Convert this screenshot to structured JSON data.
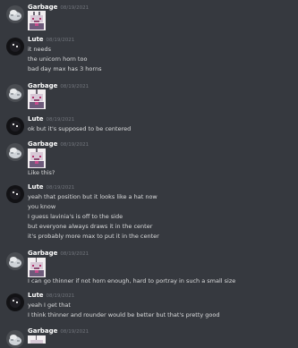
{
  "messages": [
    {
      "author": "Garbage",
      "timestamp": "08/19/2021",
      "avatar": "garbage-avatar",
      "lines": [],
      "emoji": "pixel-art-emoji"
    },
    {
      "author": "Lute",
      "timestamp": "08/19/2021",
      "avatar": "lute-avatar",
      "lines": [
        "it needs",
        "the unicorn horn too",
        "bad day max has 3 horns"
      ],
      "emoji": ""
    },
    {
      "author": "Garbage",
      "timestamp": "08/19/2021",
      "avatar": "garbage-avatar",
      "lines": [],
      "emoji": "pixel-art-emoji"
    },
    {
      "author": "Lute",
      "timestamp": "08/19/2021",
      "avatar": "lute-avatar",
      "lines": [
        "ok but it's supposed to be centered"
      ],
      "emoji": ""
    },
    {
      "author": "Garbage",
      "timestamp": "08/19/2021",
      "avatar": "garbage-avatar",
      "lines": [
        "Like this?"
      ],
      "emoji": "pixel-art-emoji"
    },
    {
      "author": "Lute",
      "timestamp": "08/19/2021",
      "avatar": "lute-avatar",
      "lines": [
        "yeah that position but it looks like a hat now",
        "you know",
        "I guess lavinia's is off to the side",
        "but everyone always draws it in the center",
        "it's probably more max to put it in the center"
      ],
      "emoji": ""
    },
    {
      "author": "Garbage",
      "timestamp": "08/19/2021",
      "avatar": "garbage-avatar",
      "lines": [
        "I can go thinner if not horn enough, hard to portray in such a small size"
      ],
      "emoji": "pixel-art-emoji"
    },
    {
      "author": "Lute",
      "timestamp": "08/19/2021",
      "avatar": "lute-avatar",
      "lines": [
        "yeah I get that",
        "I think thinner and rounder would be better but that's pretty good"
      ],
      "emoji": ""
    },
    {
      "author": "Garbage",
      "timestamp": "08/19/2021",
      "avatar": "garbage-avatar",
      "lines": [],
      "emoji": ""
    }
  ]
}
